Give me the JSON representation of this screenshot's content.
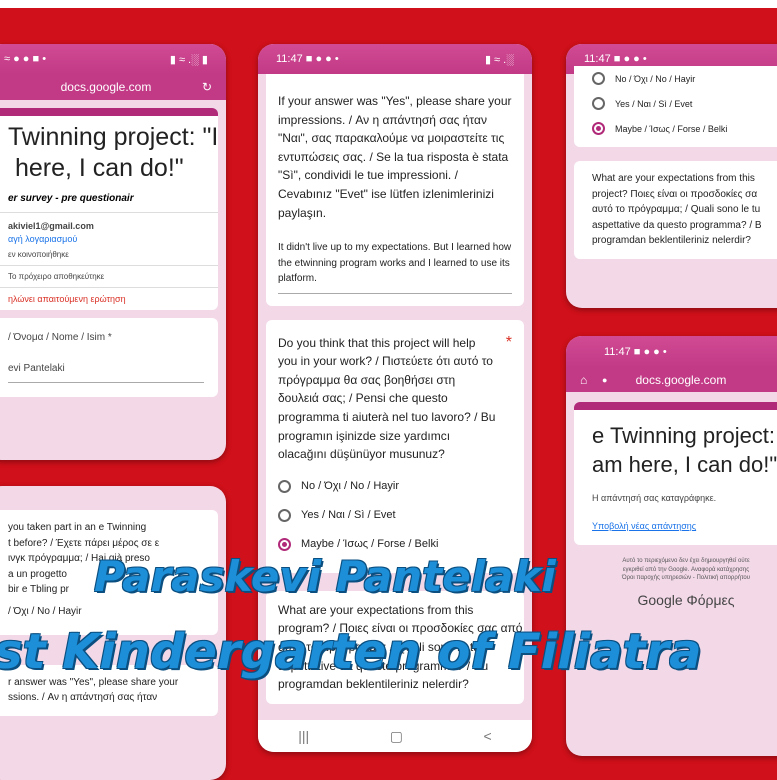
{
  "phone_left": {
    "status": "≈ ● ● ■ •",
    "status_right": "▮ ≈ .░ ▮",
    "url": "docs.google.com",
    "title": "Twinning project: \"I\n here, I can do!\"",
    "subtitle": "er survey - pre questionair",
    "email": "akiviel1@gmail.com",
    "switch_account": "αγή λογαριασμού",
    "not_shared": "εν κοινοποιήθηκε",
    "saved": "Το πρόχειρο αποθηκεύτηκε",
    "required": "ηλώνει απαιτούμενη ερώτηση",
    "name_question": "/ Όνομα / Nome / Isim *",
    "name_answer": "evi Pantelaki",
    "q_taken_part": "you taken part in an e Twinning\nt before? / Έχετε πάρει μέρος σε ε\nινγκ πρόγραμμα; / Hai già preso\na un progetto\nbir e Tbling pr",
    "opt_no": "/ Όχι / No / Hayir",
    "bottom_text": "r answer was \"Yes\", please share your\nssions. / Αν η απάντησή σας ήταν"
  },
  "phone_center": {
    "time": "11:47",
    "status_icons": "■ ● ● •",
    "status_right": "▮ ≈ .░",
    "share_prompt": "If your answer was \"Yes\", please share your impressions. / Αν η απάντησή σας ήταν \"Ναι\", σας παρακαλούμε να μοιραστείτε τις εντυπώσεις σας. / Se la tua risposta è stata \"Sì\", condividi le tue impressioni. / Cevabınız \"Evet\" ise lütfen izlenimlerinizi paylaşın.",
    "share_answer": "It didn't live up to my expectations. But I learned how the etwinning program works and I learned to use its platform.",
    "help_question": "Do you think that this project will help you in your work? / Πιστεύετε ότι αυτό το πρόγραμμα θα σας βοηθήσει στη δουλειά σας; / Pensi che questo programma ti aiuterà nel tuo lavoro? / Bu programın işinizde size yardımcı olacağını düşünüyor musunuz?",
    "options": [
      "No / Όχι / No / Hayir",
      "Yes / Ναι / Sì / Evet",
      "Maybe / Ίσως / Forse / Belki"
    ],
    "expect_question": "What are your expectations from this\nprogram? / Ποιες είναι οι προσδοκίες σας από\nαυτό το πρόγραμμα; / Quali sono le tue\naspettative da questo programma? / Bu\nprogramdan beklentileriniz nelerdir?",
    "nav": [
      "|||",
      "▢",
      "<"
    ]
  },
  "phone_right_top": {
    "time": "11:47",
    "status_icons": "■ ● ● •",
    "options": [
      "No / Όχι / No / Hayir",
      "Yes / Ναι / Sì / Evet",
      "Maybe / Ίσως / Forse / Belki"
    ],
    "expect_question": "What are your expectations from this\nproject? Ποιες είναι οι προσδοκίες σα\nαυτό το πρόγραμμα; / Quali sono le tu\naspettative da questo programma? / B\nprogramdan beklentileriniz nelerdir?"
  },
  "phone_right_bottom": {
    "time": "11:47",
    "status_icons": "■ ● ● •",
    "url": "docs.google.com",
    "title": "e Twinning project:\nam here, I can do!\"",
    "recorded": "Η απάντησή σας καταγράφηκε.",
    "submit_another": "Υποβολή νέας απάντησης",
    "disclaimer": "Αυτό το περιεχόμενο δεν έχει δημιουργηθεί ούτε\nεγκριθεί από την Google. Αναφορά κατάχρησης\nΌροι παροχής υπηρεσιών - Πολιτική απορρήτου",
    "brand": "Google Φόρμες"
  },
  "overlay": {
    "line1": "Paraskevi Pantelaki",
    "line2": "st Kindergarten of Filiatra"
  },
  "colors": {
    "background": "#d0101a",
    "form_accent": "#b12a7a",
    "overlay_text": "#1c8fd8"
  }
}
